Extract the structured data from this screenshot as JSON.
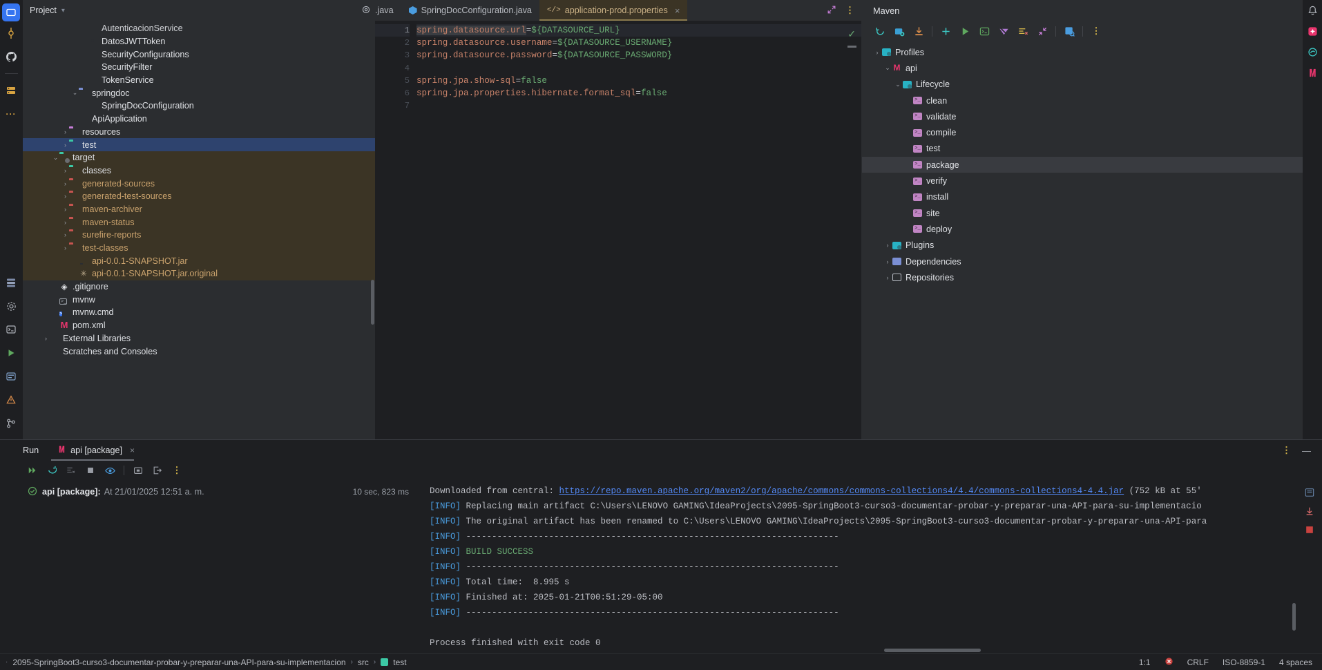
{
  "project": {
    "panel_title": "Project",
    "tree": [
      {
        "label": "AutenticacionService",
        "indent": 5,
        "icon": "class-icon",
        "arrow": "",
        "state": "clipped"
      },
      {
        "label": "DatosJWTToken",
        "indent": 5,
        "icon": "annotation-icon",
        "arrow": ""
      },
      {
        "label": "SecurityConfigurations",
        "indent": 5,
        "icon": "class-icon",
        "arrow": ""
      },
      {
        "label": "SecurityFilter",
        "indent": 5,
        "icon": "class-icon",
        "arrow": ""
      },
      {
        "label": "TokenService",
        "indent": 5,
        "icon": "class-icon",
        "arrow": ""
      },
      {
        "label": "springdoc",
        "indent": 4,
        "icon": "folder-plain-icon",
        "arrow": "v"
      },
      {
        "label": "SpringDocConfiguration",
        "indent": 5,
        "icon": "class-icon",
        "arrow": ""
      },
      {
        "label": "ApiApplication",
        "indent": 4,
        "icon": "class-green-icon",
        "arrow": ""
      },
      {
        "label": "resources",
        "indent": 3,
        "icon": "folder-resources-icon",
        "arrow": ">"
      },
      {
        "label": "test",
        "indent": 3,
        "icon": "folder-test-icon",
        "arrow": ">",
        "selected": true
      },
      {
        "label": "target",
        "indent": 2,
        "icon": "folder-excluded-icon",
        "arrow": "v",
        "excluded": true
      },
      {
        "label": "classes",
        "indent": 3,
        "icon": "folder-classes-icon",
        "arrow": ">",
        "excluded": true
      },
      {
        "label": "generated-sources",
        "indent": 3,
        "icon": "folder-icon",
        "arrow": ">",
        "excluded": true,
        "brown": true
      },
      {
        "label": "generated-test-sources",
        "indent": 3,
        "icon": "folder-icon",
        "arrow": ">",
        "excluded": true,
        "brown": true
      },
      {
        "label": "maven-archiver",
        "indent": 3,
        "icon": "folder-icon",
        "arrow": ">",
        "excluded": true,
        "brown": true
      },
      {
        "label": "maven-status",
        "indent": 3,
        "icon": "folder-icon",
        "arrow": ">",
        "excluded": true,
        "brown": true
      },
      {
        "label": "surefire-reports",
        "indent": 3,
        "icon": "folder-icon",
        "arrow": ">",
        "excluded": true,
        "brown": true
      },
      {
        "label": "test-classes",
        "indent": 3,
        "icon": "folder-icon",
        "arrow": ">",
        "excluded": true,
        "brown": true
      },
      {
        "label": "api-0.0.1-SNAPSHOT.jar",
        "indent": 4,
        "icon": "jar-icon",
        "arrow": "",
        "excluded": true,
        "brown": true
      },
      {
        "label": "api-0.0.1-SNAPSHOT.jar.original",
        "indent": 4,
        "icon": "star-icon",
        "arrow": "",
        "excluded": true,
        "brown": true
      },
      {
        "label": ".gitignore",
        "indent": 2,
        "icon": "git-icon",
        "arrow": ""
      },
      {
        "label": "mvnw",
        "indent": 2,
        "icon": "shell-icon",
        "arrow": ""
      },
      {
        "label": "mvnw.cmd",
        "indent": 2,
        "icon": "cmd-icon",
        "arrow": ""
      },
      {
        "label": "pom.xml",
        "indent": 2,
        "icon": "maven-icon",
        "arrow": ""
      },
      {
        "label": "External Libraries",
        "indent": 1,
        "icon": "library-icon",
        "arrow": ">"
      },
      {
        "label": "Scratches and Consoles",
        "indent": 1,
        "icon": "scratches-icon",
        "arrow": ""
      }
    ]
  },
  "editor": {
    "tabs": [
      {
        "label": ".java",
        "icon": "java-class-icon",
        "active": false,
        "partial": true
      },
      {
        "label": "SpringDocConfiguration.java",
        "icon": "java-class-icon",
        "active": false
      },
      {
        "label": "application-prod.properties",
        "icon": "properties-icon",
        "active": true,
        "close": "×"
      }
    ],
    "lines": [
      {
        "n": "1",
        "current": true,
        "parts": [
          {
            "t": "spring.datasource.url",
            "c": "prop hl"
          },
          {
            "t": "=",
            "c": "eq"
          },
          {
            "t": "${DATASOURCE_URL}",
            "c": "val"
          }
        ]
      },
      {
        "n": "2",
        "parts": [
          {
            "t": "spring.datasource.username",
            "c": "prop"
          },
          {
            "t": "=",
            "c": "eq"
          },
          {
            "t": "${DATASOURCE_USERNAME}",
            "c": "val"
          }
        ]
      },
      {
        "n": "3",
        "parts": [
          {
            "t": "spring.datasource.password",
            "c": "prop"
          },
          {
            "t": "=",
            "c": "eq"
          },
          {
            "t": "${DATASOURCE_PASSWORD}",
            "c": "val"
          }
        ]
      },
      {
        "n": "4",
        "parts": []
      },
      {
        "n": "5",
        "parts": [
          {
            "t": "spring.jpa.show-sql",
            "c": "prop"
          },
          {
            "t": "=",
            "c": "eq"
          },
          {
            "t": "false",
            "c": "val"
          }
        ]
      },
      {
        "n": "6",
        "parts": [
          {
            "t": "spring.jpa.properties.hibernate.format_sql",
            "c": "prop"
          },
          {
            "t": "=",
            "c": "eq"
          },
          {
            "t": "false",
            "c": "val"
          }
        ]
      },
      {
        "n": "7",
        "parts": []
      }
    ],
    "inspection_status": "✓"
  },
  "maven": {
    "title": "Maven",
    "toolbar": [
      {
        "name": "reload-icon",
        "glyph": "↻",
        "color": "#3cc8c4"
      },
      {
        "name": "add-maven-project-icon",
        "glyph": "▣",
        "color": "#4a9de0"
      },
      {
        "name": "download-sources-icon",
        "glyph": "⤓",
        "color": "#d98c4a"
      },
      {
        "name": "add-icon",
        "glyph": "+",
        "color": "#3cc8c4"
      },
      {
        "name": "run-icon",
        "glyph": "▶",
        "color": "#5fa85f"
      },
      {
        "name": "execute-goal-icon",
        "glyph": "⌨",
        "color": "#5fa85f"
      },
      {
        "name": "toggle-offline-icon",
        "glyph": "▼",
        "color": "#b07ad4"
      },
      {
        "name": "skip-tests-icon",
        "glyph": "≡",
        "color": "#d9b94a"
      },
      {
        "name": "collapse-all-icon",
        "glyph": "↖",
        "color": "#c77ed8"
      },
      {
        "name": "show-diagram-icon",
        "glyph": "▦",
        "color": "#4a9de0"
      },
      {
        "name": "more-options-icon",
        "glyph": "⋮",
        "color": "#d9b94a"
      }
    ],
    "tree": [
      {
        "label": "Profiles",
        "indent": 1,
        "arrow": ">",
        "icon": "config-icon"
      },
      {
        "label": "api",
        "indent": 2,
        "arrow": "v",
        "icon": "maven-module-icon"
      },
      {
        "label": "Lifecycle",
        "indent": 3,
        "arrow": "v",
        "icon": "config-icon"
      },
      {
        "label": "clean",
        "indent": 4,
        "arrow": "",
        "icon": "goal-icon"
      },
      {
        "label": "validate",
        "indent": 4,
        "arrow": "",
        "icon": "goal-icon"
      },
      {
        "label": "compile",
        "indent": 4,
        "arrow": "",
        "icon": "goal-icon"
      },
      {
        "label": "test",
        "indent": 4,
        "arrow": "",
        "icon": "goal-icon"
      },
      {
        "label": "package",
        "indent": 4,
        "arrow": "",
        "icon": "goal-icon",
        "hover": true
      },
      {
        "label": "verify",
        "indent": 4,
        "arrow": "",
        "icon": "goal-icon"
      },
      {
        "label": "install",
        "indent": 4,
        "arrow": "",
        "icon": "goal-icon"
      },
      {
        "label": "site",
        "indent": 4,
        "arrow": "",
        "icon": "goal-icon"
      },
      {
        "label": "deploy",
        "indent": 4,
        "arrow": "",
        "icon": "goal-icon"
      },
      {
        "label": "Plugins",
        "indent": 2,
        "arrow": ">",
        "icon": "config-icon"
      },
      {
        "label": "Dependencies",
        "indent": 2,
        "arrow": ">",
        "icon": "dependencies-icon"
      },
      {
        "label": "Repositories",
        "indent": 2,
        "arrow": ">",
        "icon": "repositories-icon"
      }
    ]
  },
  "run": {
    "panel_label": "Run",
    "tab_label": "api [package]",
    "tab_close": "×",
    "toolbar": [
      {
        "name": "rerun-icon",
        "glyph": "▶▶",
        "color": "#5fa85f"
      },
      {
        "name": "restart-icon",
        "glyph": "↺",
        "color": "#3cc8c4"
      },
      {
        "name": "filter-icon",
        "glyph": "≡",
        "color": "#6b6e76"
      },
      {
        "name": "stop-icon",
        "glyph": "■",
        "color": "#9a9ea6"
      },
      {
        "name": "toggle-visibility-icon",
        "glyph": "◉",
        "color": "#4a9de0"
      },
      {
        "name": "export-icon",
        "glyph": "❐",
        "color": "#9a9ea6"
      },
      {
        "name": "open-console-icon",
        "glyph": "⇥",
        "color": "#9a9ea6"
      },
      {
        "name": "more-options-icon",
        "glyph": "⋮",
        "color": "#d9b94a"
      }
    ],
    "result": {
      "status_icon": "✓",
      "name": "api [package]:",
      "timestamp": "At 21/01/2025 12:51 a. m.",
      "duration": "10 sec, 823 ms"
    },
    "console": [
      {
        "prefix": "",
        "text": "Downloaded from central: ",
        "link": "https://repo.maven.apache.org/maven2/org/apache/commons/commons-collections4/4.4/commons-collections4-4.4.jar",
        "suffix": " (752 kB at 55'"
      },
      {
        "prefix": "[INFO]",
        "text": " Replacing main artifact C:\\Users\\LENOVO GAMING\\IdeaProjects\\2095-SpringBoot3-curso3-documentar-probar-y-preparar-una-API-para-su-implementacio"
      },
      {
        "prefix": "[INFO]",
        "text": " The original artifact has been renamed to C:\\Users\\LENOVO GAMING\\IdeaProjects\\2095-SpringBoot3-curso3-documentar-probar-y-preparar-una-API-para"
      },
      {
        "prefix": "[INFO]",
        "text": " ------------------------------------------------------------------------"
      },
      {
        "prefix": "[INFO]",
        "text": " ",
        "green": "BUILD SUCCESS"
      },
      {
        "prefix": "[INFO]",
        "text": " ------------------------------------------------------------------------"
      },
      {
        "prefix": "[INFO]",
        "text": " Total time:  8.995 s"
      },
      {
        "prefix": "[INFO]",
        "text": " Finished at: 2025-01-21T00:51:29-05:00"
      },
      {
        "prefix": "[INFO]",
        "text": " ------------------------------------------------------------------------"
      },
      {
        "prefix": "",
        "text": ""
      },
      {
        "prefix": "",
        "text": "Process finished with exit code 0"
      }
    ]
  },
  "statusbar": {
    "breadcrumb": [
      "2095-SpringBoot3-curso3-documentar-probar-y-preparar-una-API-para-su-implementacion",
      "src",
      "test"
    ],
    "separator": "›",
    "caret": "1:1",
    "line_separator": "CRLF",
    "encoding": "ISO-8859-1",
    "indent": "4 spaces"
  },
  "left_rail": [
    {
      "name": "project-tool-icon",
      "glyph": "▣"
    },
    {
      "name": "commit-icon",
      "glyph": "⚲"
    },
    {
      "name": "github-icon",
      "glyph": "●"
    },
    {
      "name": "database-icon",
      "glyph": "☰"
    },
    {
      "name": "more-tools-icon",
      "glyph": "…"
    }
  ],
  "left_rail_bottom": [
    {
      "name": "structure-icon",
      "glyph": "≣"
    },
    {
      "name": "settings-icon",
      "glyph": "⚙"
    },
    {
      "name": "terminal-icon",
      "glyph": "▤"
    },
    {
      "name": "run-icon",
      "glyph": "▶"
    },
    {
      "name": "services-icon",
      "glyph": "▥"
    },
    {
      "name": "problems-icon",
      "glyph": "⬤"
    },
    {
      "name": "version-control-icon",
      "glyph": "⎇"
    }
  ],
  "right_rail": [
    {
      "name": "notifications-icon",
      "glyph": "🔔"
    },
    {
      "name": "ai-assistant-icon",
      "glyph": "✦"
    },
    {
      "name": "gradle-icon",
      "glyph": "◎"
    },
    {
      "name": "maven-tool-icon",
      "glyph": "m"
    }
  ]
}
